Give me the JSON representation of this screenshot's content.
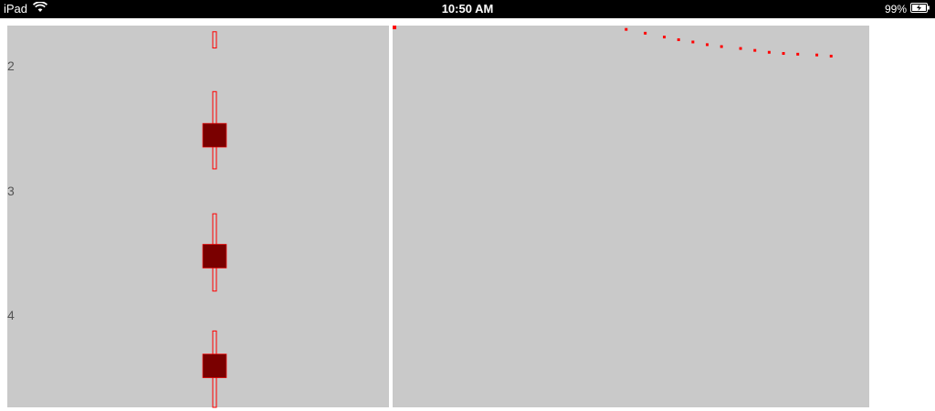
{
  "status_bar": {
    "device": "iPad",
    "time": "10:50 AM",
    "battery": "99%",
    "wifi_icon": "wifi-icon",
    "battery_icon": "battery-charging-icon"
  },
  "colors": {
    "panel_bg": "#c9c9c9",
    "box_fill": "#7a0000",
    "box_stroke": "#ff0000",
    "scatter": "#ff0000"
  },
  "chart_data": [
    {
      "type": "boxplot",
      "orientation": "vertical-categories",
      "y_ticks": [
        "2",
        "3",
        "4"
      ],
      "boxes": [
        {
          "category": "2",
          "center": 2.55,
          "whisker_low": 2.2,
          "whisker_high": 2.82
        },
        {
          "category": "3",
          "center": 3.52,
          "whisker_low": 3.18,
          "whisker_high": 3.8
        },
        {
          "category": "4",
          "center": 4.4,
          "whisker_low": 4.12,
          "whisker_high": 4.99
        }
      ],
      "partial_box_top": {
        "whisker_low": 1.72,
        "whisker_high": 1.85
      }
    },
    {
      "type": "scatter",
      "points": [
        {
          "x": 0.49,
          "y": 0.99
        },
        {
          "x": 0.53,
          "y": 0.98
        },
        {
          "x": 0.57,
          "y": 0.97
        },
        {
          "x": 0.6,
          "y": 0.963
        },
        {
          "x": 0.63,
          "y": 0.957
        },
        {
          "x": 0.66,
          "y": 0.95
        },
        {
          "x": 0.69,
          "y": 0.945
        },
        {
          "x": 0.73,
          "y": 0.94
        },
        {
          "x": 0.76,
          "y": 0.935
        },
        {
          "x": 0.79,
          "y": 0.93
        },
        {
          "x": 0.82,
          "y": 0.927
        },
        {
          "x": 0.85,
          "y": 0.925
        },
        {
          "x": 0.89,
          "y": 0.923
        },
        {
          "x": 0.92,
          "y": 0.92
        }
      ]
    }
  ]
}
